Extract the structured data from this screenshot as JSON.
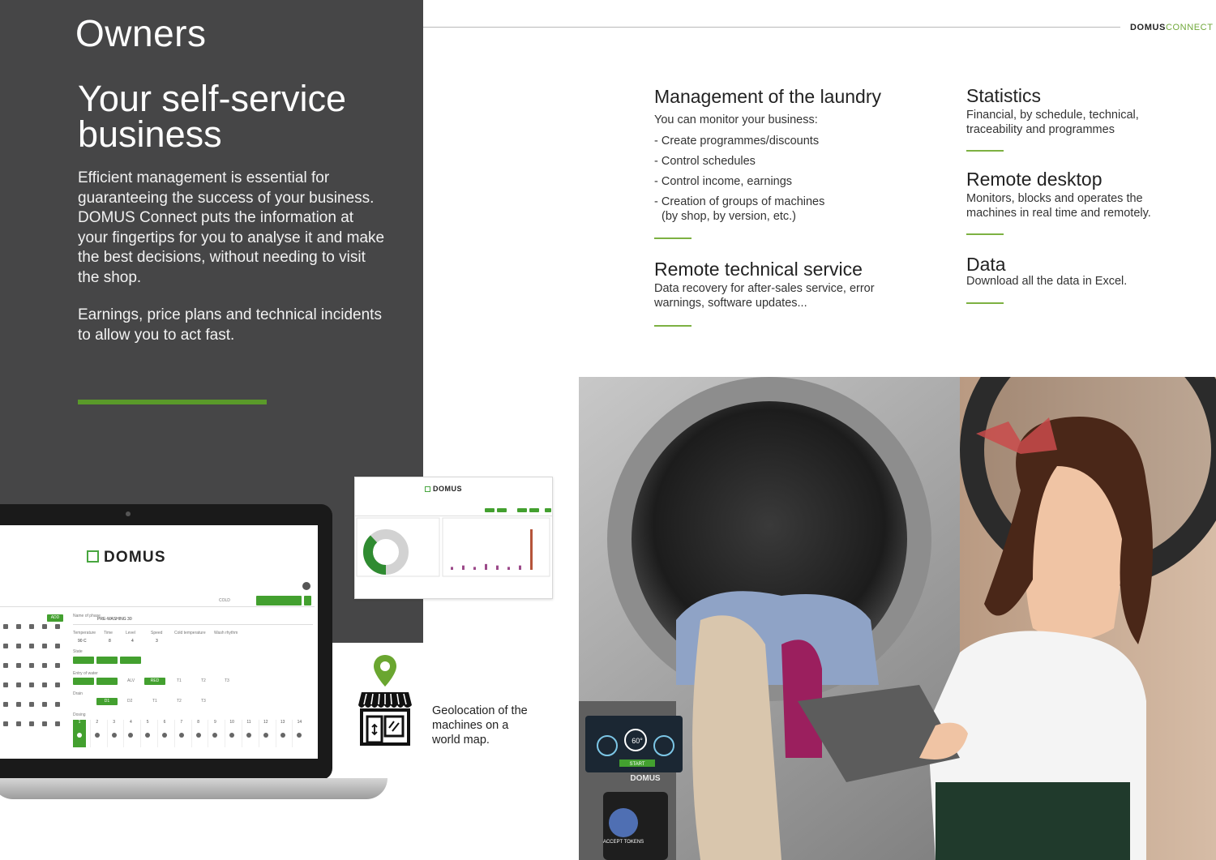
{
  "brand": {
    "part1": "DOMUS",
    "part2": "CONNECT"
  },
  "left_panel": {
    "section": "Owners",
    "title": "Your self-service business",
    "intro_1": "Efficient management is essential for guaranteeing the success of your business. DOMUS Connect puts the information at your fingertips for you to analyse it and make the best decisions, without needing to visit the shop.",
    "intro_2": "Earnings, price plans and technical incidents to allow you to act fast."
  },
  "features": {
    "management": {
      "title": "Management of the laundry",
      "lead": "You can monitor your business:",
      "items": [
        "- Create programmes/discounts",
        "- Control schedules",
        "- Control income, earnings",
        "- Creation of groups of machines",
        "(by shop, by version, etc.)"
      ]
    },
    "remote_service": {
      "title": "Remote technical service",
      "text": "Data recovery for after-sales service, error warnings, software updates..."
    },
    "statistics": {
      "title": "Statistics",
      "text": "Financial, by schedule, technical, traceability and programmes"
    },
    "remote_desktop": {
      "title": "Remote desktop",
      "text": "Monitors, blocks and operates the machines in real time and remotely."
    },
    "data": {
      "title": "Data",
      "text": "Download all the data in Excel."
    }
  },
  "laptop_screen": {
    "logo": "DOMUS",
    "add_label": "ADD",
    "name_label": "Name of phase",
    "name_value": "PRE-WASHING 30",
    "cold_label": "COLD",
    "params": [
      "Temperature",
      "Time",
      "Level",
      "Speed",
      "Cold temperature",
      "Wash rhythm"
    ],
    "param_values": [
      "90 C",
      "8",
      "4",
      "3",
      "",
      ""
    ],
    "state_label": "State",
    "entry_label": "Entry of water",
    "entry_options": [
      "ALV",
      "RED",
      "T1",
      "T2",
      "T3"
    ],
    "drain_label": "Drain",
    "drain_options": [
      "D1",
      "D2",
      "T1",
      "T2",
      "T3"
    ],
    "dosing_label": "Dosing",
    "dosing_numbers": [
      "1",
      "2",
      "3",
      "4",
      "5",
      "6",
      "7",
      "8",
      "9",
      "10",
      "11",
      "12",
      "13",
      "14"
    ]
  },
  "dashboard": {
    "logo": "DOMUS",
    "donut_fraction": 0.38,
    "bars": [
      2,
      3,
      2,
      4,
      3,
      2,
      3,
      28
    ]
  },
  "geolocation": {
    "caption": "Geolocation of the machines on a world map."
  },
  "machine_panel": {
    "brand": "DOMUS",
    "temp": "60°",
    "start": "START",
    "tokens": "ACCEPT TOKENS"
  },
  "colors": {
    "accent_green": "#7db142",
    "panel_gray": "#464647",
    "brand_green": "#43a02f"
  }
}
